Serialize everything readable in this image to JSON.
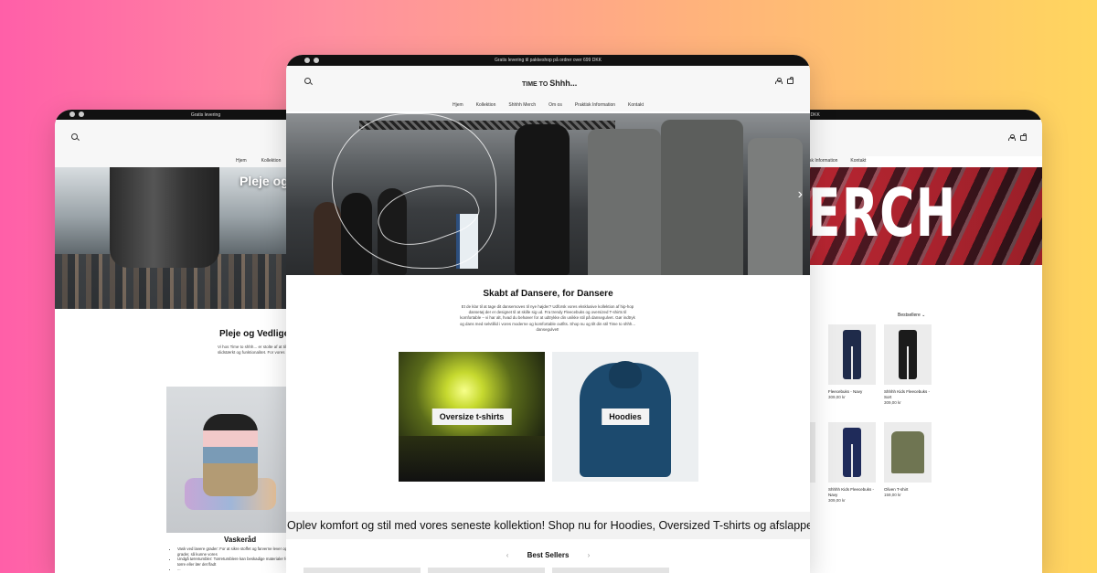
{
  "left_page": {
    "announcement": "Gratis levering",
    "nav": [
      "Hjem",
      "Kollektion",
      "Sh"
    ],
    "hero_title": "Pleje og",
    "section_title": "Pleje og Vedligeh",
    "section_text": "Vi hos Time to shhh... er stolte af at tilbyde tøj beviser en slidstærkt og funktionalitet. For vores bedste råd til pleje",
    "care_title": "Vaskeråd",
    "care_list": [
      "Vask ved lavere grader: For at sikre stoffet og farverne lever op tøj, anbefaler vi at vaske ved lavere grader, så kunne vores",
      "Undgå tørretumbler: Tørretumblere kan beskadige materialer for at bevare kvaliteten. Hæng tøjet til tørre eller lær det fladt",
      "..."
    ]
  },
  "right_page": {
    "nav_tail": [
      "ktisk Information",
      "Kontakt"
    ],
    "announcement_tail": "f 699 DKK",
    "hero_title": "ERCH",
    "sort_label": "Bestsellere",
    "products": [
      {
        "name": "Fleecebuks - Navy",
        "price": "309,00 kr",
        "color": "#1f2b4a",
        "kind": "pant"
      },
      {
        "name": "Shhhh Kids Fleecebuks - Sort",
        "price": "309,00 kr",
        "color": "#1b1b1b",
        "kind": "pant"
      },
      {
        "name": "Shhhh Kids Fleecebuks - Navy",
        "price": "309,00 kr",
        "color": "#1f2b5a",
        "kind": "pant"
      },
      {
        "name": "Oliven T-shirt",
        "price": "159,00 kr",
        "color": "#6f7552",
        "kind": "tee"
      }
    ]
  },
  "center_page": {
    "announcement": "Gratis levering til pakkeshop på ordrer over 699 DKK",
    "logo_text": "TIME TO",
    "logo_accent": "Shhh...",
    "nav": [
      "Hjem",
      "Kollektion",
      "Shhhh Merch",
      "Om os",
      "Praktisk Information",
      "Kontakt"
    ],
    "intro_title": "Skabt af Dansere, for Dansere",
    "intro_text": "Et de klar til at tage dit dansemoves til nye højder? Udforsk vores eksklusive kollektion af hip-hop dansetøj der er designet til at skille sig ud. Fra trendy Fleecebuks og oversized T-shirts til komfortable – vi har alt, hvad du behøver for at udtrykke din unikke stil på dansegulvet. Gør indtryk og dans med selvtillid i vores moderne og komfortable outfits. Shop nu og tilt din stil Time to shhh... dansegulvet!",
    "collections": [
      {
        "label": "Oversize t-shirts"
      },
      {
        "label": "Hoodies"
      }
    ],
    "marquee": "Oplev komfort og stil med vores seneste kollektion! Shop nu for Hoodies, Oversized T-shirts og afslappende",
    "best_sellers": "Best Sellers",
    "prev": "‹",
    "next": "›"
  }
}
